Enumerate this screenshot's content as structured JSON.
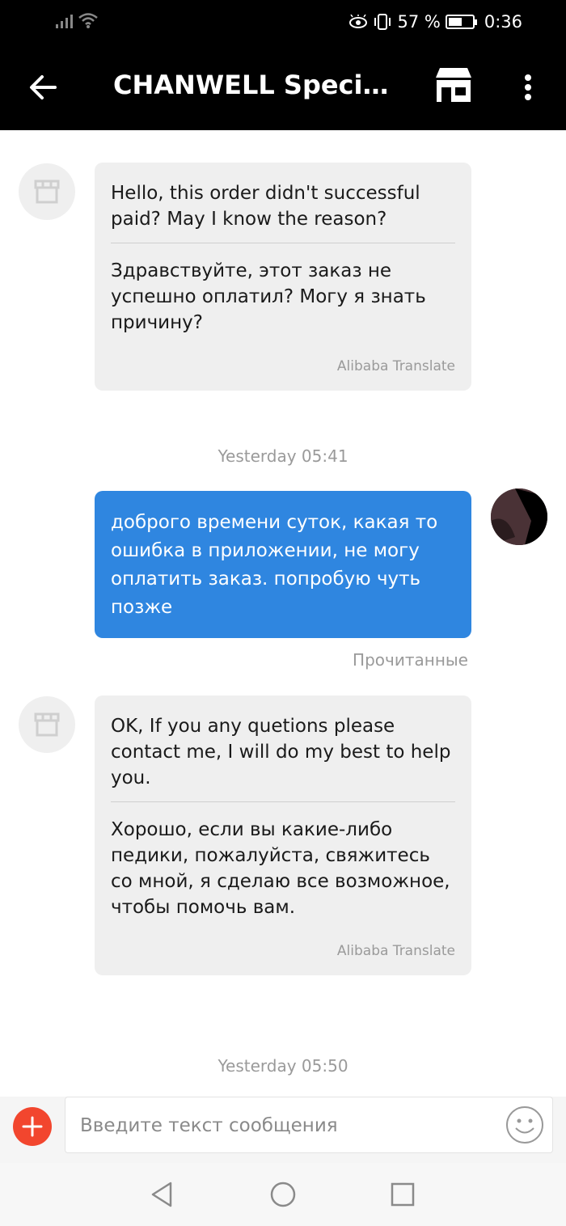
{
  "status_bar": {
    "battery_text": "57 %",
    "battery_level": 0.57,
    "time": "0:36"
  },
  "app_bar": {
    "title": "CHANWELL Specialt..."
  },
  "messages": [
    {
      "original": "Hello, this order didn't successful paid? May I know the reason?",
      "translated": "Здравствуйте, этот заказ не успешно оплатил? Могу я знать причину?",
      "source": "Alibaba Translate"
    },
    {
      "original": "OK, If you any quetions please contact me, I will do my best to help you.",
      "translated": "Хорошо, если вы какие-либо педики, пожалуйста, свяжитесь со мной, я сделаю все возможное, чтобы помочь вам.",
      "source": "Alibaba Translate"
    }
  ],
  "timestamps": [
    "Yesterday 05:41",
    "Yesterday 05:50"
  ],
  "outgoing": {
    "text": "доброго времени суток, какая то ошибка в приложении, не могу оплатить заказ. попробую чуть позже",
    "status": "Прочитанные"
  },
  "input": {
    "placeholder": "Введите текст сообщения"
  },
  "colors": {
    "header_bg": "#000000",
    "outgoing_bubble": "#2f86e0",
    "incoming_bubble": "#efefef",
    "plus_button": "#f2462e"
  }
}
